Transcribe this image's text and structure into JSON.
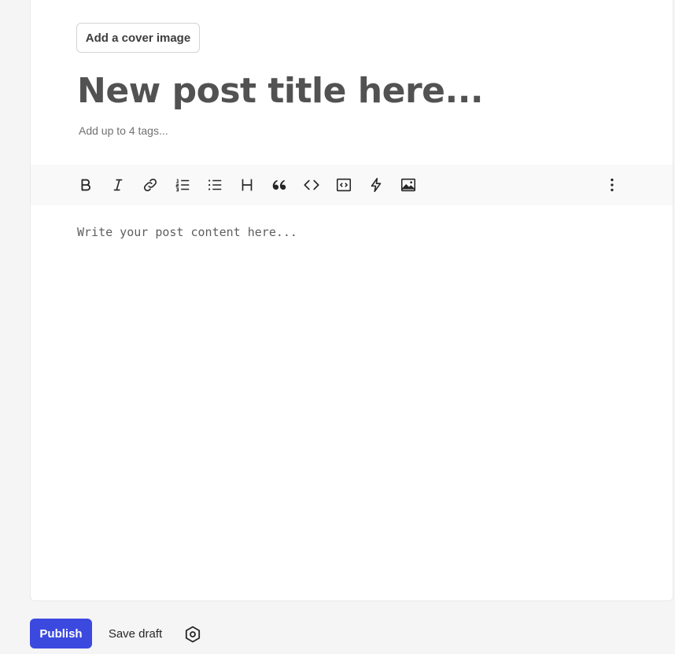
{
  "editor": {
    "cover_button_label": "Add a cover image",
    "title_placeholder": "New post title here...",
    "tags_placeholder": "Add up to 4 tags...",
    "content_placeholder": "Write your post content here..."
  },
  "toolbar": {
    "items": [
      {
        "name": "bold",
        "icon": "bold-icon"
      },
      {
        "name": "italic",
        "icon": "italic-icon"
      },
      {
        "name": "link",
        "icon": "link-icon"
      },
      {
        "name": "ordered-list",
        "icon": "ordered-list-icon"
      },
      {
        "name": "unordered-list",
        "icon": "unordered-list-icon"
      },
      {
        "name": "heading",
        "icon": "heading-icon"
      },
      {
        "name": "quote",
        "icon": "quote-icon"
      },
      {
        "name": "code",
        "icon": "code-icon"
      },
      {
        "name": "code-block",
        "icon": "code-block-icon"
      },
      {
        "name": "embed",
        "icon": "lightning-icon"
      },
      {
        "name": "image",
        "icon": "image-icon"
      },
      {
        "name": "more",
        "icon": "more-vertical-icon"
      }
    ]
  },
  "footer": {
    "publish_label": "Publish",
    "save_draft_label": "Save draft",
    "settings_icon": "settings-icon"
  },
  "colors": {
    "accent": "#3b49df",
    "page_background": "#f5f5f5",
    "toolbar_background": "#f9f9f9"
  }
}
